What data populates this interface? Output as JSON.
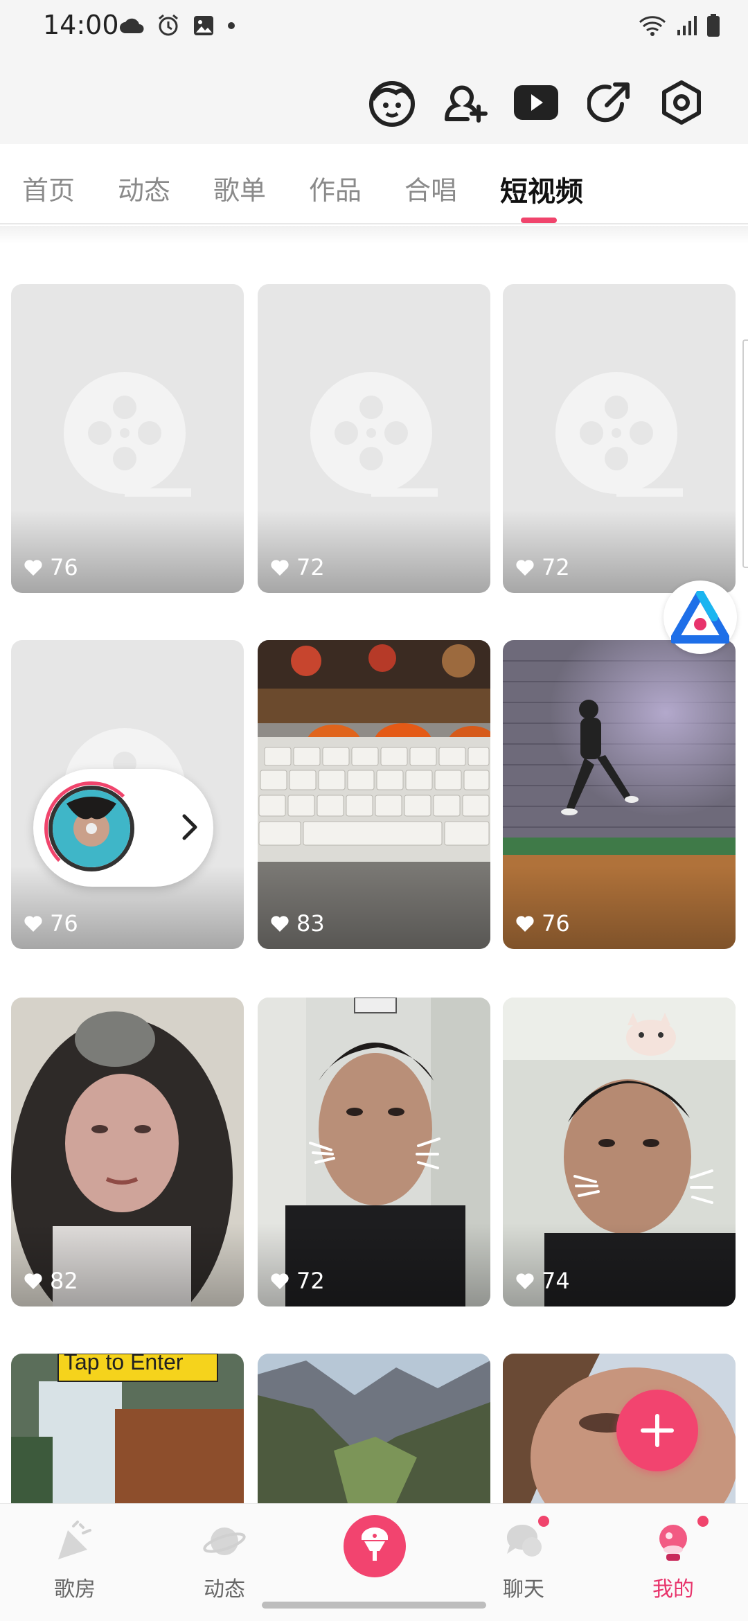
{
  "status_bar": {
    "time": "14:00",
    "left_icons": [
      "cloud-icon",
      "alarm-icon",
      "gallery-icon",
      "dot-icon"
    ],
    "right_icons": [
      "wifi-icon",
      "signal-icon",
      "battery-icon"
    ]
  },
  "top_bar": {
    "icons": [
      "face-avatar-icon",
      "add-friend-icon",
      "video-play-icon",
      "share-icon",
      "settings-hexagon-icon"
    ]
  },
  "tabs": {
    "items": [
      {
        "label": "首页",
        "active": false
      },
      {
        "label": "动态",
        "active": false
      },
      {
        "label": "歌单",
        "active": false
      },
      {
        "label": "作品",
        "active": false
      },
      {
        "label": "合唱",
        "active": false
      },
      {
        "label": "短视频",
        "active": true
      }
    ],
    "accent_color": "#f0446c"
  },
  "videos": [
    {
      "likes": "76",
      "thumb": "placeholder"
    },
    {
      "likes": "72",
      "thumb": "placeholder"
    },
    {
      "likes": "72",
      "thumb": "placeholder"
    },
    {
      "likes": "76",
      "thumb": "placeholder"
    },
    {
      "likes": "83",
      "thumb": "keyboard"
    },
    {
      "likes": "76",
      "thumb": "dancer"
    },
    {
      "likes": "82",
      "thumb": "portrait-woman"
    },
    {
      "likes": "72",
      "thumb": "man-cat-filter"
    },
    {
      "likes": "74",
      "thumb": "man-cat-ears"
    },
    {
      "likes": "",
      "thumb": "tap-to-enter",
      "overlay_text": "Tap to Enter"
    },
    {
      "likes": "",
      "thumb": "mountain-valley"
    },
    {
      "likes": "",
      "thumb": "close-up-face"
    }
  ],
  "floating": {
    "service_icon": "service-logo-icon",
    "player_chevron": "chevron-right-icon",
    "fab_icon": "plus-icon"
  },
  "bottom_nav": {
    "items": [
      {
        "label": "歌房",
        "icon": "party-popper-icon",
        "active": false,
        "badge": false
      },
      {
        "label": "动态",
        "icon": "planet-icon",
        "active": false,
        "badge": false
      },
      {
        "label": "",
        "icon": "microphone-icon",
        "active": false,
        "badge": false
      },
      {
        "label": "聊天",
        "icon": "chat-bubble-icon",
        "active": false,
        "badge": true
      },
      {
        "label": "我的",
        "icon": "profile-orb-icon",
        "active": true,
        "badge": true
      }
    ]
  }
}
